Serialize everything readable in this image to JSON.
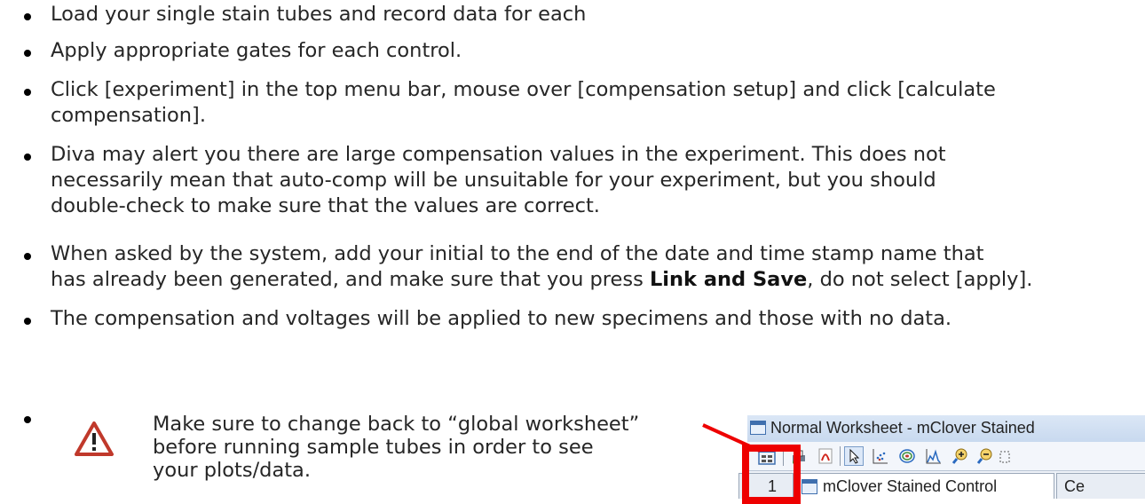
{
  "bullets": [
    {
      "lines": [
        "Load your single stain tubes and record data for each"
      ]
    },
    {
      "lines": [
        "Apply appropriate gates for each control."
      ]
    },
    {
      "lines": [
        "Click [experiment] in the top menu bar, mouse over [compensation setup] and click [calculate",
        "compensation]."
      ]
    },
    {
      "lines": [
        "Diva may alert you there are large compensation values in the experiment. This does not",
        "necessarily mean that auto-comp will be unsuitable for your experiment, but you should",
        "double-check to make sure that the values are correct."
      ]
    },
    {
      "line1": "When asked by the system, add your initial to the end of the date and time stamp name that",
      "line2_before": "has already been generated, and make sure that you press ",
      "line2_bold": "Link and Save",
      "line2_after": ", do not select [apply]."
    },
    {
      "lines": [
        "The compensation and voltages will be applied to new specimens and those with no data."
      ]
    }
  ],
  "warning": {
    "lines": [
      "Make sure to change back to “global worksheet”",
      "before running sample tubes in order to see",
      "your plots/data."
    ],
    "icon": "warning-triangle-icon",
    "icon_color": "#c0392b"
  },
  "snippet": {
    "title": "Normal Worksheet - mClover Stained",
    "tab_partial": "1",
    "tab_active": "mClover Stained Control",
    "tab_next": "Ce",
    "highlight_color": "#ee0000"
  }
}
